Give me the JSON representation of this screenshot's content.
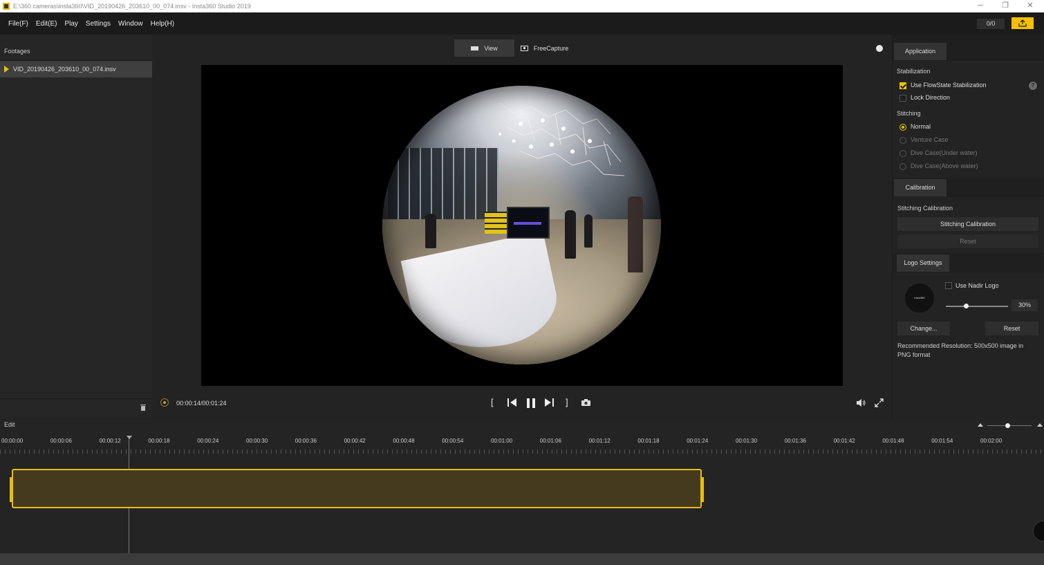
{
  "titlebar": {
    "title": "E:\\360 cameras\\insta360\\VID_20190426_203610_00_074.insv - Insta360 Studio 2019"
  },
  "menu": [
    "File(F)",
    "Edit(E)",
    "Play",
    "Settings",
    "Window",
    "Help(H)"
  ],
  "counter": "0/0",
  "footages": {
    "title": "Footages",
    "items": [
      "VID_20190426_203610_00_074.insv"
    ]
  },
  "tabs": {
    "view": "View",
    "freecapture": "FreeCapture"
  },
  "player": {
    "time": "00:00:14/00:01:24"
  },
  "right": {
    "application_tab": "Application",
    "stabilization_title": "Stabilization",
    "flowstate": "Use FlowState Stabilization",
    "lock_direction": "Lock Direction",
    "help_glyph": "?",
    "stitching_title": "Stitching",
    "stitch_options": [
      "Normal",
      "Venture Case",
      "Dive Case(Under water)",
      "Dive Case(Above water)"
    ],
    "calibration_tab": "Calibration",
    "stitching_calibration_title": "Stitching Calibration",
    "stitching_calibration_btn": "Stitching Calibration",
    "reset_btn": "Reset",
    "logo_tab": "Logo Settings",
    "use_nadir": "Use Nadir Logo",
    "logo_text": "insta360",
    "opacity": "30%",
    "change_btn": "Change...",
    "logo_reset_btn": "Reset",
    "recommend": "Recommended Resolution: 500x500 image in PNG format"
  },
  "timeline": {
    "edit_label": "Edit",
    "ticks": [
      "00:00:00",
      "00:00:06",
      "00:00:12",
      "00:00:18",
      "00:00:24",
      "00:00:30",
      "00:00:36",
      "00:00:42",
      "00:00:48",
      "00:00:54",
      "00:01:00",
      "00:01:06",
      "00:01:12",
      "00:01:18",
      "00:01:24",
      "00:01:30",
      "00:01:36",
      "00:01:42",
      "00:01:48",
      "00:01:54",
      "00:02:00"
    ],
    "playhead_time": "00:00:14"
  },
  "colors": {
    "accent": "#f3c200",
    "clip_fill": "#463a1e"
  },
  "icons": [
    "app-icon",
    "minimize-icon",
    "restore-icon",
    "close-icon",
    "export-icon",
    "play-triangle-icon",
    "trash-icon",
    "view-icon",
    "freecapture-icon",
    "record-dot-icon",
    "target-icon",
    "mark-in-icon",
    "prev-frame-icon",
    "pause-icon",
    "next-frame-icon",
    "mark-out-icon",
    "camera-icon",
    "volume-icon",
    "fullscreen-icon",
    "help-icon",
    "zoom-out-icon",
    "zoom-in-icon"
  ]
}
